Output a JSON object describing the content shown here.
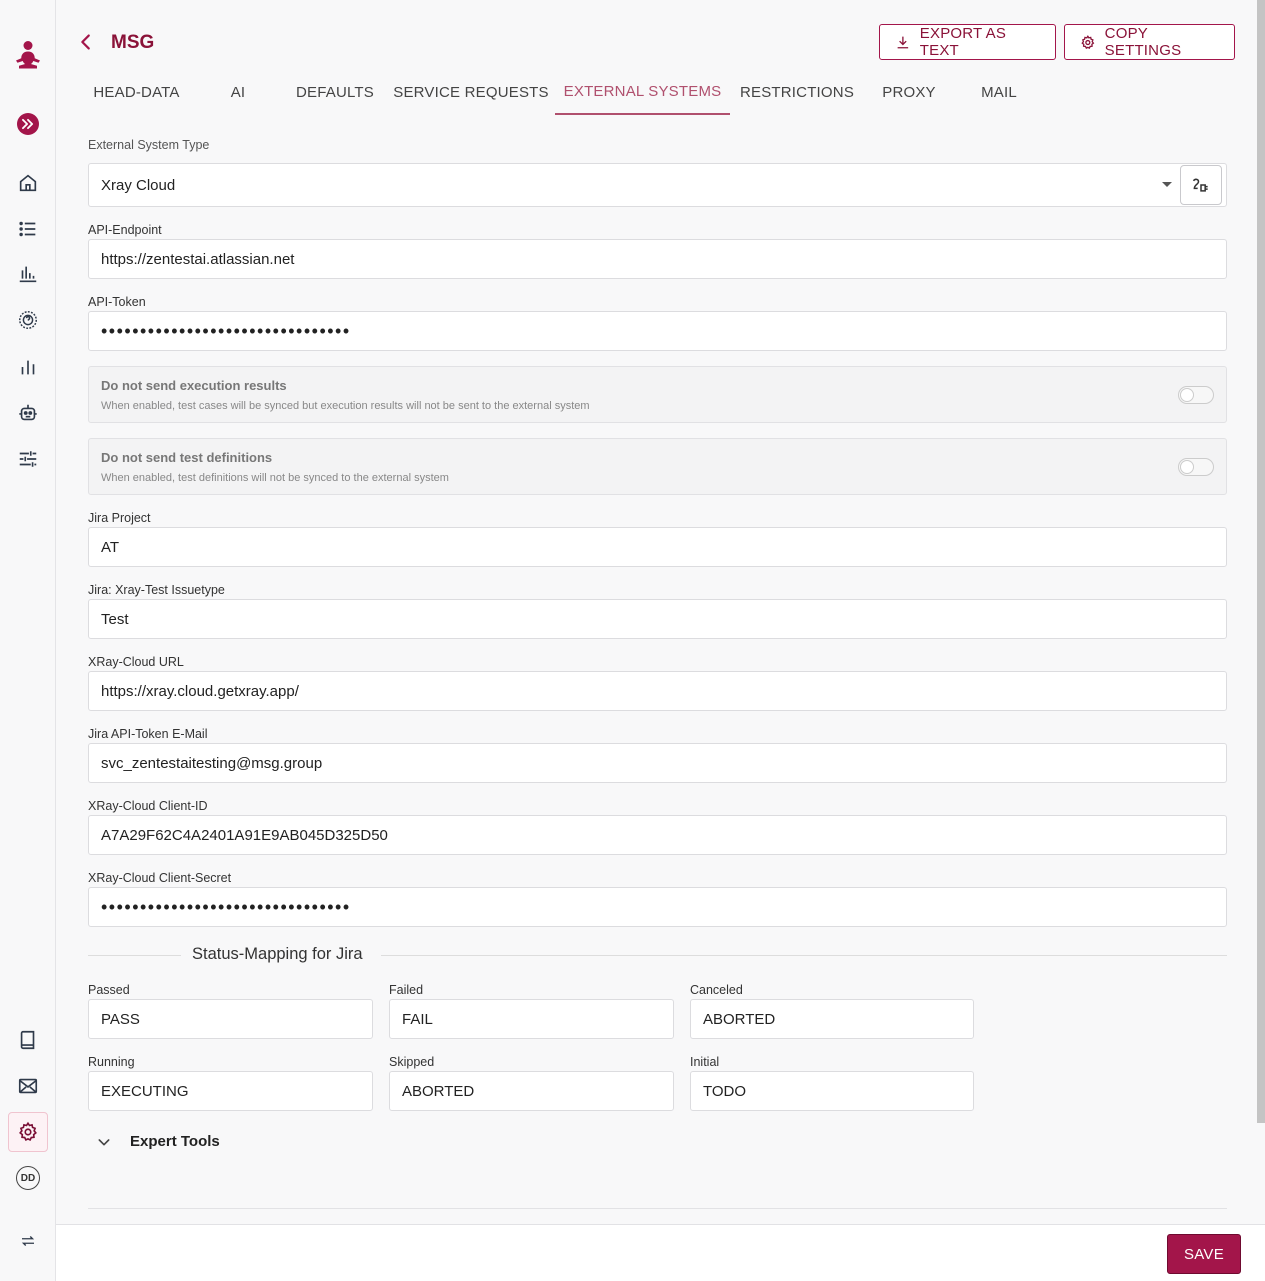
{
  "header": {
    "title": "MSG",
    "export_label": "EXPORT AS TEXT",
    "copy_label": "COPY SETTINGS"
  },
  "tabs": [
    {
      "label": "HEAD-DATA"
    },
    {
      "label": "AI"
    },
    {
      "label": "DEFAULTS"
    },
    {
      "label": "SERVICE REQUESTS"
    },
    {
      "label": "EXTERNAL SYSTEMS",
      "active": true
    },
    {
      "label": "RESTRICTIONS"
    },
    {
      "label": "PROXY"
    },
    {
      "label": "MAIL"
    }
  ],
  "form": {
    "system_type": {
      "label": "External System Type",
      "value": "Xray Cloud"
    },
    "api_endpoint": {
      "label": "API-Endpoint",
      "value": "https://zentestai.atlassian.net"
    },
    "api_token": {
      "label": "API-Token",
      "value": "••••••••••••••••••••••••••••••••"
    },
    "no_exec_results": {
      "title": "Do not send execution results",
      "desc": "When enabled, test cases will be synced but execution results will not be sent to the external system",
      "enabled": false
    },
    "no_test_defs": {
      "title": "Do not send test definitions",
      "desc": "When enabled, test definitions will not be synced to the external system",
      "enabled": false
    },
    "jira_project": {
      "label": "Jira Project",
      "value": "AT"
    },
    "issuetype": {
      "label": "Jira: Xray-Test Issuetype",
      "value": "Test"
    },
    "xray_url": {
      "label": "XRay-Cloud URL",
      "value": "https://xray.cloud.getxray.app/"
    },
    "token_email": {
      "label": "Jira API-Token E-Mail",
      "value": "svc_zentestaitesting@msg.group"
    },
    "client_id": {
      "label": "XRay-Cloud Client-ID",
      "value": "A7A29F62C4A2401A91E9AB045D325D50"
    },
    "client_secret": {
      "label": "XRay-Cloud Client-Secret",
      "value": "••••••••••••••••••••••••••••••••"
    }
  },
  "status_mapping": {
    "title": "Status-Mapping for Jira",
    "passed": {
      "label": "Passed",
      "value": "PASS"
    },
    "failed": {
      "label": "Failed",
      "value": "FAIL"
    },
    "canceled": {
      "label": "Canceled",
      "value": "ABORTED"
    },
    "running": {
      "label": "Running",
      "value": "EXECUTING"
    },
    "skipped": {
      "label": "Skipped",
      "value": "ABORTED"
    },
    "initial": {
      "label": "Initial",
      "value": "TODO"
    }
  },
  "expert_tools": {
    "label": "Expert Tools"
  },
  "footer": {
    "save_label": "SAVE"
  },
  "sidebar": {
    "avatar_initials": "DD"
  },
  "colors": {
    "accent": "#a3154a",
    "active_tab": "#b0506e"
  }
}
